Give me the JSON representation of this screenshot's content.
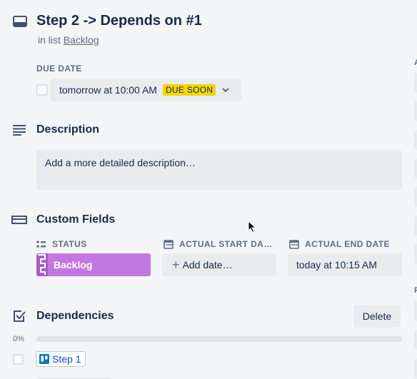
{
  "card": {
    "title": "Step 2 -> Depends on #1",
    "in_list_prefix": "in list",
    "list_name": "Backlog"
  },
  "due_date": {
    "heading": "DUE DATE",
    "value": "tomorrow at 10:00 AM",
    "badge": "DUE SOON",
    "badge_color": "#f2d600"
  },
  "description": {
    "heading": "Description",
    "placeholder": "Add a more detailed description…"
  },
  "custom_fields": {
    "heading": "Custom Fields",
    "fields": [
      {
        "label": "STATUS",
        "value": "Backlog",
        "icon": "list-icon",
        "color": "#c377e0"
      },
      {
        "label": "ACTUAL START DA…",
        "value": "Add date…",
        "icon": "calendar-icon"
      },
      {
        "label": "ACTUAL END DATE",
        "value": "today at 10:15 AM",
        "icon": "calendar-icon"
      }
    ]
  },
  "dependencies": {
    "heading": "Dependencies",
    "delete_label": "Delete",
    "progress_label": "0%",
    "progress": 0,
    "items": [
      {
        "label": "Step 1",
        "icon": "board-icon"
      }
    ]
  },
  "sidebar": {
    "labels": [
      "A",
      "P"
    ]
  },
  "colors": {
    "background": "#f4f5f7",
    "button": "#e9ebee",
    "text": "#172b4d",
    "muted": "#5e6c84",
    "link": "#0052cc"
  }
}
